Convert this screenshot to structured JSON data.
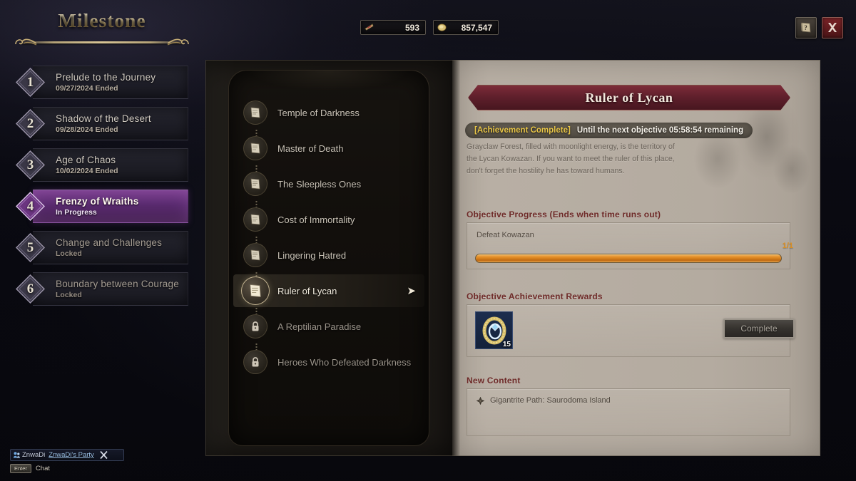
{
  "header": {
    "title": "Milestone"
  },
  "currency": [
    {
      "icon": "ticket-icon",
      "value": "593"
    },
    {
      "icon": "gold-coin-icon",
      "value": "857,547"
    }
  ],
  "top_buttons": [
    {
      "name": "help-button",
      "icon": "question-book-icon",
      "label": "?"
    },
    {
      "name": "close-button",
      "icon": "close-x-icon",
      "label": "X"
    }
  ],
  "sidebar": {
    "items": [
      {
        "num": "1",
        "name": "Prelude to the Journey",
        "status": "09/27/2024 Ended",
        "state": "ended"
      },
      {
        "num": "2",
        "name": "Shadow of the Desert",
        "status": "09/28/2024 Ended",
        "state": "ended"
      },
      {
        "num": "3",
        "name": "Age of Chaos",
        "status": "10/02/2024 Ended",
        "state": "ended"
      },
      {
        "num": "4",
        "name": "Frenzy of Wraiths",
        "status": "In Progress",
        "state": "active"
      },
      {
        "num": "5",
        "name": "Change and Challenges",
        "status": "Locked",
        "state": "locked"
      },
      {
        "num": "6",
        "name": "Boundary between Courage",
        "status": "Locked",
        "state": "locked"
      }
    ]
  },
  "quest_list": {
    "items": [
      {
        "label": "Temple of Darkness",
        "icon": "scroll-icon",
        "state": "normal"
      },
      {
        "label": "Master of Death",
        "icon": "scroll-icon",
        "state": "normal"
      },
      {
        "label": "The Sleepless Ones",
        "icon": "scroll-icon",
        "state": "normal"
      },
      {
        "label": "Cost of Immortality",
        "icon": "scroll-icon",
        "state": "normal"
      },
      {
        "label": "Lingering Hatred",
        "icon": "scroll-icon",
        "state": "normal"
      },
      {
        "label": "Ruler of Lycan",
        "icon": "scroll-icon",
        "state": "selected"
      },
      {
        "label": "A Reptilian Paradise",
        "icon": "lock-icon",
        "state": "locked"
      },
      {
        "label": "Heroes Who Defeated Darkness",
        "icon": "lock-icon",
        "state": "locked"
      }
    ]
  },
  "detail": {
    "banner_title": "Ruler of Lycan",
    "status_tag": "[Achievement Complete]",
    "status_time": "Until the next objective 05:58:54 remaining",
    "description": [
      "Grayclaw Forest, filled with moonlight energy, is the territory of",
      "the Lycan Kowazan. If you want to meet the ruler of this place,",
      "don't forget the hostility he has toward humans."
    ],
    "progress": {
      "section_title": "Objective Progress (Ends when time runs out)",
      "objective": "Defeat Kowazan",
      "count": "1/1",
      "percent": 100
    },
    "rewards": {
      "section_title": "Objective Achievement Rewards",
      "item_icon": "ring-item-icon",
      "item_qty": "15",
      "button_label": "Complete"
    },
    "new_content": {
      "section_title": "New Content",
      "icon": "gem-node-icon",
      "label": "Gigantrite Path: Saurodoma Island"
    }
  },
  "chat": {
    "player_name": "ZnwaDi",
    "party_name": "ZnwaDi's Party",
    "enter_key": "Enter",
    "hint": "Chat"
  },
  "colors": {
    "accent_gold": "#e3cf9e",
    "active_purple": "#7a3f8e",
    "banner_red": "#7d2c39",
    "progress_orange": "#e08a22",
    "achievement_yellow": "#e8c547",
    "section_title_red": "#6e2a28"
  }
}
